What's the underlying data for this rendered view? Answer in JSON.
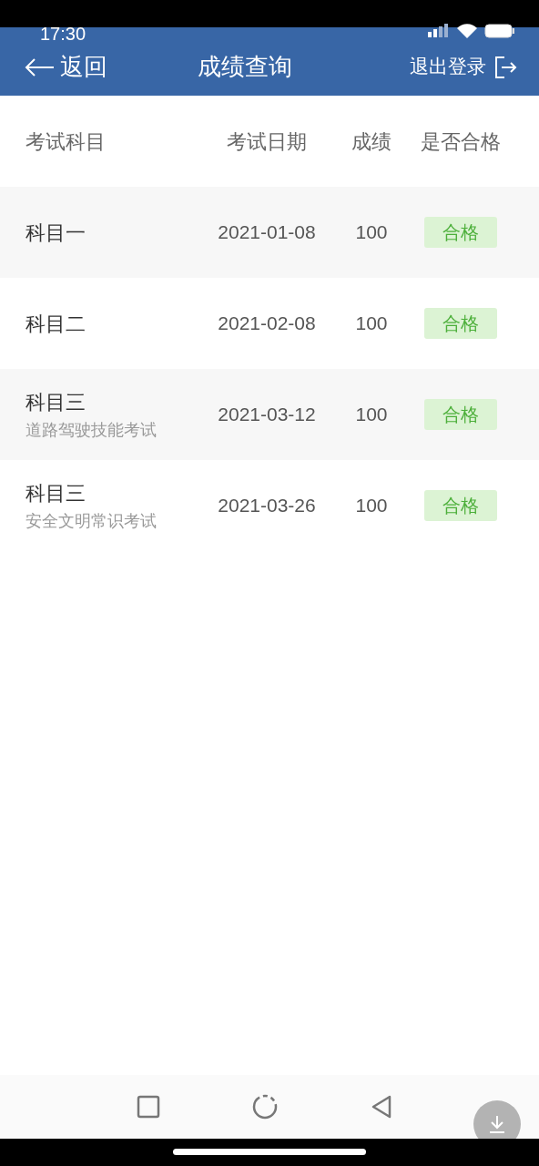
{
  "status_bar": {
    "time": "17:30"
  },
  "header": {
    "back": "返回",
    "title": "成绩查询",
    "logout": "退出登录"
  },
  "table": {
    "columns": [
      "考试科目",
      "考试日期",
      "成绩",
      "是否合格"
    ],
    "rows": [
      {
        "subject": "科目一",
        "date": "2021-01-08",
        "score": "100",
        "result": "合格",
        "passed": true
      },
      {
        "subject": "科目二",
        "date": "2021-02-08",
        "score": "100",
        "result": "合格",
        "passed": true
      },
      {
        "subject": "科目三",
        "subtitle": "道路驾驶技能考试",
        "date": "2021-03-12",
        "score": "100",
        "result": "合格",
        "passed": true
      },
      {
        "subject": "科目三",
        "subtitle": "安全文明常识考试",
        "date": "2021-03-26",
        "score": "100",
        "result": "合格",
        "passed": true
      }
    ]
  }
}
